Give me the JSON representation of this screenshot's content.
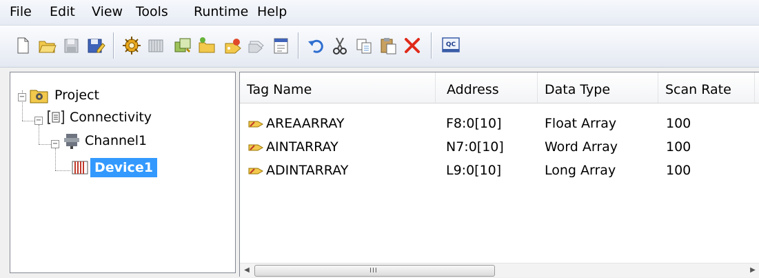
{
  "menu": [
    "File",
    "Edit",
    "View",
    "Tools",
    "Runtime",
    "Help"
  ],
  "toolbar": {
    "icons": [
      "new-icon",
      "open-icon",
      "save-icon",
      "save-as-icon",
      "new-channel-icon",
      "new-device-icon",
      "duplicate-icon",
      "new-tag-group-icon",
      "new-tag-icon",
      "bulk-tags-icon",
      "properties-icon",
      "undo-icon",
      "cut-icon",
      "copy-icon",
      "paste-icon",
      "delete-icon",
      "quick-client-icon"
    ],
    "quick_client_label": "QC"
  },
  "tree": {
    "project": "Project",
    "connectivity": "Connectivity",
    "channel": "Channel1",
    "device": "Device1",
    "selection_color": "#3399ff"
  },
  "list": {
    "columns": [
      "Tag Name",
      "Address",
      "Data Type",
      "Scan Rate"
    ],
    "rows": [
      {
        "name": "AREAARRAY",
        "address": "F8:0[10]",
        "type": "Float Array",
        "rate": "100"
      },
      {
        "name": "AINTARRAY",
        "address": "N7:0[10]",
        "type": "Word Array",
        "rate": "100"
      },
      {
        "name": "ADINTARRAY",
        "address": "L9:0[10]",
        "type": "Long Array",
        "rate": "100"
      }
    ],
    "scroll_grip": "III"
  }
}
